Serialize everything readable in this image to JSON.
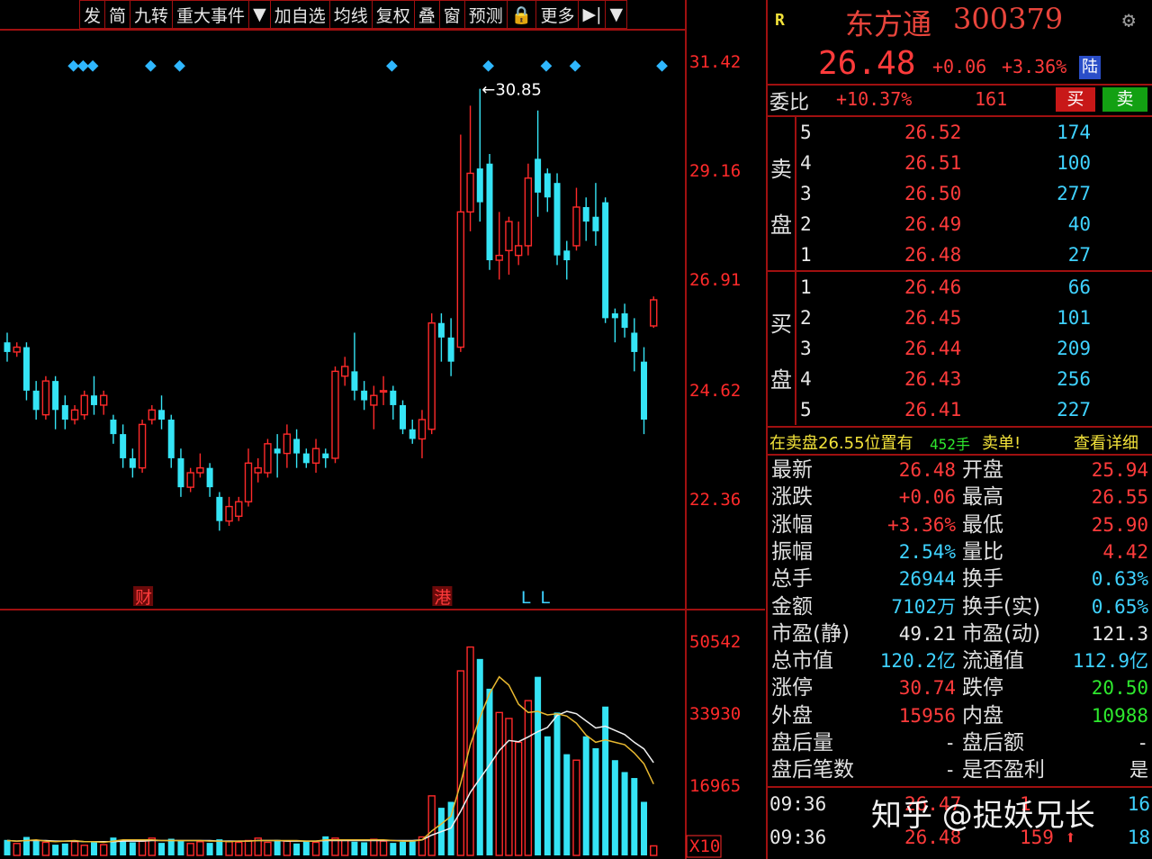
{
  "toolbar": {
    "items": [
      "发",
      "简",
      "九转",
      "重大事件",
      "▼",
      "加自选",
      "均线",
      "复权",
      "叠",
      "窗",
      "预测",
      "🔒",
      "更多",
      "▶|",
      "▼"
    ]
  },
  "stock": {
    "r_mark": "R",
    "name": "东方通",
    "code": "300379",
    "price": "26.48",
    "change": "+0.06",
    "change_pct": "+3.36%",
    "market_tag": "陆",
    "settings_icon": "gear-icon"
  },
  "weibi": {
    "label": "委比",
    "pct": "+10.37%",
    "diff": "161",
    "buy_label": "买",
    "sell_label": "卖"
  },
  "sell_side": {
    "label_top": "卖",
    "label_bottom": "盘",
    "levels": [
      {
        "n": "5",
        "price": "26.52",
        "vol": "174"
      },
      {
        "n": "4",
        "price": "26.51",
        "vol": "100"
      },
      {
        "n": "3",
        "price": "26.50",
        "vol": "277"
      },
      {
        "n": "2",
        "price": "26.49",
        "vol": "40"
      },
      {
        "n": "1",
        "price": "26.48",
        "vol": "27"
      }
    ]
  },
  "buy_side": {
    "label_top": "买",
    "label_bottom": "盘",
    "levels": [
      {
        "n": "1",
        "price": "26.46",
        "vol": "66"
      },
      {
        "n": "2",
        "price": "26.45",
        "vol": "101"
      },
      {
        "n": "3",
        "price": "26.44",
        "vol": "209"
      },
      {
        "n": "4",
        "price": "26.43",
        "vol": "256"
      },
      {
        "n": "5",
        "price": "26.41",
        "vol": "227"
      }
    ]
  },
  "alert": {
    "prefix": "在卖盘26.55位置有",
    "qty": "452手",
    "suffix": "卖单!",
    "link": "查看详细"
  },
  "stats": [
    {
      "l1": "最新",
      "v1": "26.48",
      "c1": "red",
      "l2": "开盘",
      "v2": "25.94",
      "c2": "red"
    },
    {
      "l1": "涨跌",
      "v1": "+0.06",
      "c1": "red",
      "l2": "最高",
      "v2": "26.55",
      "c2": "red"
    },
    {
      "l1": "涨幅",
      "v1": "+3.36%",
      "c1": "red",
      "l2": "最低",
      "v2": "25.90",
      "c2": "red"
    },
    {
      "l1": "振幅",
      "v1": "2.54%",
      "c1": "cyan",
      "l2": "量比",
      "v2": "4.42",
      "c2": "red"
    },
    {
      "l1": "总手",
      "v1": "26944",
      "c1": "cyan",
      "l2": "换手",
      "v2": "0.63%",
      "c2": "cyan"
    },
    {
      "l1": "金额",
      "v1": "7102万",
      "c1": "cyan",
      "l2": "换手(实)",
      "v2": "0.65%",
      "c2": "cyan"
    },
    {
      "l1": "市盈(静)",
      "v1": "49.21",
      "c1": "white",
      "l2": "市盈(动)",
      "v2": "121.3",
      "c2": "white"
    },
    {
      "l1": "总市值",
      "v1": "120.2亿",
      "c1": "cyan",
      "l2": "流通值",
      "v2": "112.9亿",
      "c2": "cyan"
    },
    {
      "l1": "涨停",
      "v1": "30.74",
      "c1": "red",
      "l2": "跌停",
      "v2": "20.50",
      "c2": "green"
    },
    {
      "l1": "外盘",
      "v1": "15956",
      "c1": "red",
      "l2": "内盘",
      "v2": "10988",
      "c2": "green"
    },
    {
      "l1": "盘后量",
      "v1": "-",
      "c1": "white",
      "l2": "盘后额",
      "v2": "-",
      "c2": "white"
    },
    {
      "l1": "盘后笔数",
      "v1": "-",
      "c1": "white",
      "l2": "是否盈利",
      "v2": "是",
      "c2": "white"
    }
  ],
  "ticks": [
    {
      "time": "09:36",
      "price": "26.47",
      "vol": "1",
      "trail": "16",
      "dir": ""
    },
    {
      "time": "09:36",
      "price": "26.48",
      "vol": "159",
      "trail": "18",
      "dir": "up-arrow-icon"
    }
  ],
  "watermark": "知乎 @捉妖兄长",
  "chart_data": {
    "type": "candlestick",
    "price_axis": [
      "31.42",
      "29.16",
      "26.91",
      "24.62",
      "22.36"
    ],
    "volume_axis": [
      "50542",
      "33930",
      "16965",
      "X10"
    ],
    "high_marker": "30.85",
    "event_marks": [
      "财",
      "港",
      "L",
      "L"
    ],
    "candles": [
      {
        "o": 25.6,
        "c": 25.4,
        "h": 25.8,
        "l": 25.2
      },
      {
        "o": 25.4,
        "c": 25.5,
        "h": 25.6,
        "l": 25.3
      },
      {
        "o": 25.5,
        "c": 24.6,
        "h": 25.6,
        "l": 24.4
      },
      {
        "o": 24.6,
        "c": 24.2,
        "h": 24.8,
        "l": 24.0
      },
      {
        "o": 24.1,
        "c": 24.8,
        "h": 24.9,
        "l": 24.0
      },
      {
        "o": 24.8,
        "c": 24.2,
        "h": 24.9,
        "l": 23.8
      },
      {
        "o": 24.3,
        "c": 24.0,
        "h": 24.5,
        "l": 23.8
      },
      {
        "o": 24.0,
        "c": 24.2,
        "h": 24.3,
        "l": 23.9
      },
      {
        "o": 24.1,
        "c": 24.5,
        "h": 24.6,
        "l": 24.0
      },
      {
        "o": 24.5,
        "c": 24.3,
        "h": 24.9,
        "l": 24.1
      },
      {
        "o": 24.3,
        "c": 24.5,
        "h": 24.6,
        "l": 24.1
      },
      {
        "o": 24.0,
        "c": 23.7,
        "h": 24.1,
        "l": 23.5
      },
      {
        "o": 23.7,
        "c": 23.2,
        "h": 23.9,
        "l": 23.0
      },
      {
        "o": 23.2,
        "c": 23.0,
        "h": 23.4,
        "l": 22.8
      },
      {
        "o": 23.0,
        "c": 23.9,
        "h": 24.0,
        "l": 22.9
      },
      {
        "o": 24.0,
        "c": 24.2,
        "h": 24.3,
        "l": 23.9
      },
      {
        "o": 24.2,
        "c": 24.0,
        "h": 24.5,
        "l": 23.8
      },
      {
        "o": 24.0,
        "c": 23.2,
        "h": 24.1,
        "l": 23.0
      },
      {
        "o": 23.2,
        "c": 22.6,
        "h": 23.4,
        "l": 22.4
      },
      {
        "o": 22.6,
        "c": 22.9,
        "h": 23.0,
        "l": 22.5
      },
      {
        "o": 22.9,
        "c": 23.0,
        "h": 23.3,
        "l": 22.8
      },
      {
        "o": 23.0,
        "c": 22.6,
        "h": 23.1,
        "l": 22.4
      },
      {
        "o": 22.4,
        "c": 21.9,
        "h": 22.5,
        "l": 21.7
      },
      {
        "o": 21.9,
        "c": 22.2,
        "h": 22.4,
        "l": 21.8
      },
      {
        "o": 22.0,
        "c": 22.3,
        "h": 22.4,
        "l": 21.9
      },
      {
        "o": 22.3,
        "c": 23.1,
        "h": 23.4,
        "l": 22.2
      },
      {
        "o": 22.9,
        "c": 23.0,
        "h": 23.2,
        "l": 22.7
      },
      {
        "o": 22.9,
        "c": 23.5,
        "h": 23.6,
        "l": 22.8
      },
      {
        "o": 23.4,
        "c": 23.3,
        "h": 23.7,
        "l": 22.8
      },
      {
        "o": 23.3,
        "c": 23.7,
        "h": 23.9,
        "l": 23.0
      },
      {
        "o": 23.6,
        "c": 23.3,
        "h": 23.8,
        "l": 23.0
      },
      {
        "o": 23.3,
        "c": 23.1,
        "h": 23.4,
        "l": 23.0
      },
      {
        "o": 23.1,
        "c": 23.4,
        "h": 23.6,
        "l": 22.9
      },
      {
        "o": 23.3,
        "c": 23.2,
        "h": 23.4,
        "l": 23.0
      },
      {
        "o": 23.2,
        "c": 25.0,
        "h": 25.1,
        "l": 23.1
      },
      {
        "o": 24.9,
        "c": 25.1,
        "h": 25.3,
        "l": 24.7
      },
      {
        "o": 25.0,
        "c": 24.6,
        "h": 25.8,
        "l": 24.4
      },
      {
        "o": 24.6,
        "c": 24.4,
        "h": 24.8,
        "l": 24.2
      },
      {
        "o": 24.3,
        "c": 24.5,
        "h": 24.7,
        "l": 23.8
      },
      {
        "o": 24.6,
        "c": 24.6,
        "h": 24.9,
        "l": 24.3
      },
      {
        "o": 24.6,
        "c": 24.3,
        "h": 24.7,
        "l": 24.0
      },
      {
        "o": 24.3,
        "c": 23.8,
        "h": 24.4,
        "l": 23.7
      },
      {
        "o": 23.8,
        "c": 23.6,
        "h": 24.0,
        "l": 23.5
      },
      {
        "o": 23.6,
        "c": 24.0,
        "h": 24.2,
        "l": 23.2
      },
      {
        "o": 23.8,
        "c": 26.0,
        "h": 26.2,
        "l": 23.7
      },
      {
        "o": 26.0,
        "c": 25.7,
        "h": 26.2,
        "l": 25.2
      },
      {
        "o": 25.7,
        "c": 25.2,
        "h": 26.1,
        "l": 24.9
      },
      {
        "o": 25.5,
        "c": 28.3,
        "h": 29.9,
        "l": 25.4
      },
      {
        "o": 28.3,
        "c": 29.1,
        "h": 30.5,
        "l": 27.9
      },
      {
        "o": 29.2,
        "c": 28.5,
        "h": 30.85,
        "l": 28.1
      },
      {
        "o": 29.3,
        "c": 27.3,
        "h": 29.5,
        "l": 27.1
      },
      {
        "o": 27.3,
        "c": 27.4,
        "h": 28.3,
        "l": 26.9
      },
      {
        "o": 27.5,
        "c": 28.1,
        "h": 28.2,
        "l": 27.0
      },
      {
        "o": 27.4,
        "c": 27.6,
        "h": 28.1,
        "l": 27.2
      },
      {
        "o": 27.6,
        "c": 29.0,
        "h": 29.3,
        "l": 27.4
      },
      {
        "o": 29.4,
        "c": 28.7,
        "h": 30.4,
        "l": 28.2
      },
      {
        "o": 29.1,
        "c": 28.6,
        "h": 29.2,
        "l": 28.3
      },
      {
        "o": 28.9,
        "c": 27.4,
        "h": 29.1,
        "l": 27.2
      },
      {
        "o": 27.5,
        "c": 27.3,
        "h": 27.7,
        "l": 26.9
      },
      {
        "o": 27.6,
        "c": 28.4,
        "h": 28.8,
        "l": 27.5
      },
      {
        "o": 28.4,
        "c": 28.1,
        "h": 28.6,
        "l": 27.7
      },
      {
        "o": 28.2,
        "c": 27.9,
        "h": 28.9,
        "l": 27.6
      },
      {
        "o": 28.5,
        "c": 26.1,
        "h": 28.6,
        "l": 26.0
      },
      {
        "o": 26.2,
        "c": 26.1,
        "h": 26.3,
        "l": 25.6
      },
      {
        "o": 26.2,
        "c": 25.9,
        "h": 26.4,
        "l": 25.7
      },
      {
        "o": 25.8,
        "c": 25.4,
        "h": 26.1,
        "l": 25.0
      },
      {
        "o": 25.2,
        "c": 24.0,
        "h": 25.5,
        "l": 23.7
      },
      {
        "o": 25.94,
        "c": 26.48,
        "h": 26.55,
        "l": 25.9
      }
    ],
    "volumes": [
      2.6,
      2.0,
      3.1,
      2.4,
      2.2,
      1.8,
      2.0,
      2.3,
      1.7,
      2.4,
      1.8,
      3.0,
      2.6,
      2.2,
      2.4,
      2.9,
      2.1,
      2.8,
      2.4,
      2.0,
      2.3,
      2.1,
      2.7,
      2.3,
      2.2,
      2.5,
      2.9,
      2.2,
      2.6,
      2.4,
      2.0,
      2.4,
      2.2,
      3.2,
      2.9,
      2.6,
      2.3,
      2.2,
      2.7,
      2.4,
      2.1,
      2.3,
      2.5,
      3.1,
      10.0,
      8.0,
      9.0,
      31.0,
      35.0,
      33.0,
      28.0,
      24.0,
      23.0,
      19.0,
      26.0,
      30.0,
      20.0,
      24.0,
      17.0,
      16.0,
      20.0,
      18.0,
      25.0,
      16.0,
      14.0,
      13.0,
      9.0,
      1.6
    ],
    "ma5": [
      2.5,
      2.4,
      2.5,
      2.6,
      2.4,
      2.3,
      2.4,
      2.5,
      2.3,
      2.3,
      2.2,
      2.4,
      2.6,
      2.6,
      2.6,
      2.6,
      2.5,
      2.5,
      2.5,
      2.5,
      2.5,
      2.4,
      2.4,
      2.3,
      2.4,
      2.4,
      2.5,
      2.5,
      2.5,
      2.5,
      2.5,
      2.4,
      2.4,
      2.6,
      2.6,
      2.6,
      2.6,
      2.6,
      2.6,
      2.6,
      2.5,
      2.4,
      2.4,
      2.6,
      4.1,
      5.3,
      6.6,
      12.1,
      18.6,
      23.2,
      27.2,
      30.0,
      28.6,
      25.4,
      24.0,
      24.2,
      23.6,
      23.8,
      23.4,
      22.2,
      20.2,
      19.0,
      19.4,
      19.0,
      18.6,
      17.2,
      15.4,
      12.0
    ],
    "ma10": [
      2.5,
      2.4,
      2.5,
      2.5,
      2.5,
      2.4,
      2.4,
      2.4,
      2.3,
      2.3,
      2.3,
      2.3,
      2.4,
      2.4,
      2.4,
      2.5,
      2.5,
      2.5,
      2.5,
      2.5,
      2.5,
      2.5,
      2.4,
      2.4,
      2.4,
      2.4,
      2.5,
      2.5,
      2.5,
      2.4,
      2.4,
      2.4,
      2.4,
      2.5,
      2.5,
      2.5,
      2.5,
      2.5,
      2.5,
      2.5,
      2.5,
      2.5,
      2.5,
      2.6,
      3.4,
      4.0,
      4.6,
      7.4,
      10.6,
      12.9,
      15.2,
      17.6,
      19.3,
      19.1,
      19.9,
      20.8,
      21.5,
      23.5,
      24.2,
      23.8,
      22.6,
      21.4,
      21.7,
      21.0,
      20.3,
      19.0,
      17.9,
      15.6
    ],
    "diamond_markers_at": [
      12,
      13,
      14,
      20,
      23,
      45,
      55,
      61,
      64,
      73
    ]
  }
}
